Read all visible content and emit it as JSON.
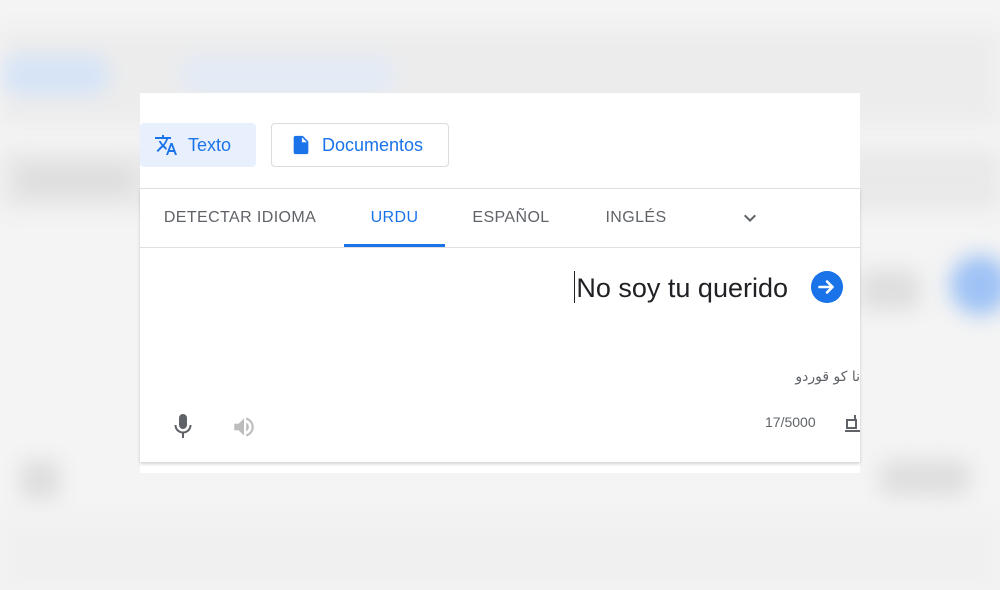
{
  "colors": {
    "accent": "#1a73e8",
    "muted_icon": "#5f6368",
    "disabled_icon": "#bdbdbd"
  },
  "modes": {
    "text_label": "Texto",
    "text_icon": "translate-icon",
    "documents_label": "Documentos",
    "documents_icon": "document-icon"
  },
  "language_tabs": [
    {
      "label": "DETECTAR IDIOMA",
      "active": false
    },
    {
      "label": "URDU",
      "active": true
    },
    {
      "label": "ESPAÑOL",
      "active": false
    },
    {
      "label": "INGLÉS",
      "active": false
    }
  ],
  "source": {
    "text": "No soy tu querido",
    "transliteration": "نا کو قوردو",
    "char_count": "17/5000"
  }
}
